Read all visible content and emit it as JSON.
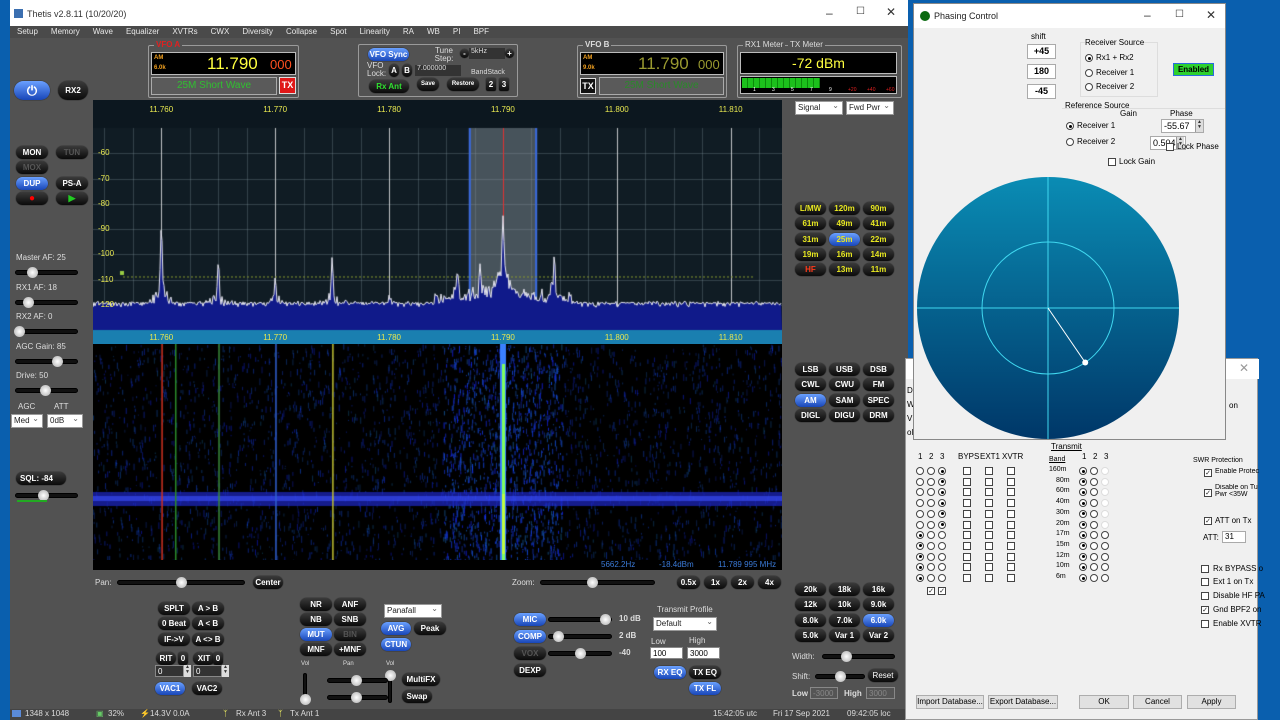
{
  "window": {
    "title": "Thetis v2.8.11 (10/20/20)"
  },
  "menu": [
    "Setup",
    "Memory",
    "Wave",
    "Equalizer",
    "XVTRs",
    "CWX",
    "Diversity",
    "Collapse",
    "Spot",
    "Linearity",
    "RA",
    "WB",
    "PI",
    "BPF"
  ],
  "vfo_a": {
    "label": "VFO A",
    "mode": "AM",
    "filter": "6.0k",
    "freq_main": "11.790",
    "freq_sub": "000",
    "band": "25M Short Wave",
    "tx": "TX"
  },
  "vfo_b": {
    "label": "VFO B",
    "mode": "AM",
    "filter": "9.0k",
    "freq_main": "11.790",
    "freq_sub": "000",
    "band": "25M Short Wave",
    "tx": "TX"
  },
  "vfo_ctrl": {
    "sync": "VFO Sync",
    "tune_step_label": "Tune Step:",
    "tune_step": "5kHz",
    "minus": "-",
    "plus": "+",
    "lock_label": "VFO Lock:",
    "a": "A",
    "b": "B",
    "freq_field": "7.000000",
    "bandstack": "BandStack",
    "rx_ant": "Rx Ant",
    "save": "Save",
    "restore": "Restore",
    "n2": "2",
    "n3": "3"
  },
  "meter": {
    "rx1_label": "RX1 Meter",
    "tx_label": "TX Meter",
    "reading": "-72 dBm",
    "scale": [
      "1",
      "3",
      "5",
      "7",
      "9",
      "+20",
      "+40",
      "+60"
    ],
    "level_fraction": 0.5,
    "rx_select": "Signal",
    "tx_select": "Fwd Pwr"
  },
  "power": {
    "rx2": "RX2"
  },
  "left": {
    "buttons": [
      {
        "label": "MON"
      },
      {
        "label": "TUN",
        "disabled": true
      },
      {
        "label": "MOX",
        "disabled": true
      },
      {
        "label": "DUP",
        "active": true
      },
      {
        "label": "PS-A"
      }
    ],
    "sliders": [
      {
        "label": "Master AF:",
        "value": "25",
        "pos": 0.27
      },
      {
        "label": "RX1 AF:",
        "value": "18",
        "pos": 0.2
      },
      {
        "label": "RX2 AF:",
        "value": "0",
        "pos": 0.05
      },
      {
        "label": "AGC Gain:",
        "value": "85",
        "pos": 0.68
      },
      {
        "label": "Drive:",
        "value": "50",
        "pos": 0.48
      }
    ],
    "agc_label": "AGC",
    "att_label": "ATT",
    "agc": "Med",
    "att": "0dB",
    "sql": "SQL: -84",
    "sql_pos": 0.45
  },
  "spectrum": {
    "freq_ticks": [
      "11.760",
      "11.770",
      "11.780",
      "11.790",
      "11.800",
      "11.810"
    ],
    "freq_values": [
      11.76,
      11.77,
      11.78,
      11.79,
      11.8,
      11.81
    ],
    "freq_range": [
      11.754,
      11.8145
    ],
    "db_ticks": [
      "-60",
      "-70",
      "-80",
      "-90",
      "-100",
      "-110",
      "-120"
    ],
    "db_range": [
      -50,
      -130
    ],
    "noise_floor": -122,
    "squelch_level": -109,
    "vfo_freq": 11.79,
    "filter_khz": [
      -3,
      3
    ],
    "peaks": [
      {
        "f": 11.76,
        "db": -89
      },
      {
        "f": 11.765,
        "db": -104
      },
      {
        "f": 11.77,
        "db": -109
      },
      {
        "f": 11.775,
        "db": -102
      },
      {
        "f": 11.78,
        "db": -116
      },
      {
        "f": 11.786,
        "db": -109
      },
      {
        "f": 11.79,
        "db": -88
      },
      {
        "f": 11.7945,
        "db": -105
      },
      {
        "f": 11.788,
        "db": -108
      }
    ],
    "readout": {
      "hz": "5662.2Hz",
      "dbm": "-18.4dBm",
      "mhz": "11.789 995 MHz"
    }
  },
  "bands": [
    "L/MW",
    "120m",
    "90m",
    "61m",
    "49m",
    "41m",
    "31m",
    "25m",
    "22m",
    "19m",
    "16m",
    "14m",
    "HF",
    "13m",
    "11m"
  ],
  "band_active": "25m",
  "modes": [
    "LSB",
    "USB",
    "DSB",
    "CWL",
    "CWU",
    "FM",
    "AM",
    "SAM",
    "SPEC",
    "DIGL",
    "DIGU",
    "DRM"
  ],
  "mode_active": "AM",
  "pan": {
    "label": "Pan:",
    "pos": 0.5,
    "center": "Center"
  },
  "zoom": {
    "label": "Zoom:",
    "pos": 0.45,
    "buttons": [
      "0.5x",
      "1x",
      "2x",
      "4x"
    ]
  },
  "vfo_buttons": [
    "SPLT",
    "A > B",
    "0 Beat",
    "A < B",
    "IF->V",
    "A <> B"
  ],
  "rit": {
    "rit": "RIT",
    "rit_val": "0",
    "xit": "XIT",
    "xit_val": "0",
    "rit_field": "0",
    "xit_field": "0"
  },
  "vac": [
    "VAC1",
    "VAC2"
  ],
  "dsp": [
    {
      "label": "NR"
    },
    {
      "label": "ANF"
    },
    {
      "label": "NB"
    },
    {
      "label": "SNB"
    },
    {
      "label": "MUT",
      "active": true
    },
    {
      "label": "BIN",
      "disabled": true
    },
    {
      "label": "MNF"
    },
    {
      "label": "+MNF"
    }
  ],
  "display": {
    "mode": "Panafall",
    "avg": "AVG",
    "peak": "Peak",
    "ctun": "CTUN",
    "vol": "Vol",
    "pan": "Pan",
    "vol2": "Vol",
    "multifx": "MultiFX",
    "swap": "Swap"
  },
  "tx": [
    {
      "label": "MIC",
      "active": true,
      "value": "10 dB",
      "pos": 0.9
    },
    {
      "label": "COMP",
      "active": true,
      "value": "2 dB",
      "pos": 0.15
    },
    {
      "label": "VOX",
      "disabled": true,
      "value": "-40",
      "pos": 0.5
    },
    {
      "label": "DEXP"
    }
  ],
  "tx_profile": {
    "label": "Transmit Profile",
    "value": "Default",
    "low_label": "Low",
    "high_label": "High",
    "low": "100",
    "high": "3000",
    "rx_eq": "RX EQ",
    "tx_eq": "TX EQ",
    "tx_fl": "TX FL"
  },
  "filters": [
    "20k",
    "18k",
    "16k",
    "12k",
    "10k",
    "9.0k",
    "8.0k",
    "7.0k",
    "6.0k",
    "5.0k",
    "Var 1",
    "Var 2"
  ],
  "filter_active": "6.0k",
  "filter_ctrl": {
    "width": "Width:",
    "shift": "Shift:",
    "reset": "Reset",
    "low": "Low",
    "high": "High",
    "low_val": "-3000",
    "high_val": "3000",
    "width_pos": 0.33,
    "shift_pos": 0.5
  },
  "status": {
    "resolution": "1348 x 1048",
    "cpu": "32%",
    "power": "14.3V  0.0A",
    "rx_ant": "Rx Ant 3",
    "tx_ant": "Tx Ant 1",
    "utc": "15:42:05 utc",
    "date": "Fri 17 Sep 2021",
    "local": "09:42:05 loc"
  },
  "phasing": {
    "title": "Phasing Control",
    "shift_label": "shift",
    "shifts": [
      "+45",
      "180",
      "-45"
    ],
    "receiver_source": "Receiver Source",
    "rx_options": [
      "Rx1 + Rx2",
      "Receiver 1",
      "Receiver 2"
    ],
    "rx_selected": 0,
    "enabled": "Enabled",
    "reference_source": "Reference Source",
    "ref_options": [
      "Receiver 1",
      "Receiver 2"
    ],
    "ref_selected": 0,
    "gain_label": "Gain",
    "gain": "0.504",
    "phase_label": "Phase",
    "phase": "-55.67",
    "lock_phase": "Lock Phase",
    "lock_gain": "Lock Gain",
    "gain_value": 0.504,
    "phase_value": -55.67
  },
  "setup": {
    "side_letters": [
      "D",
      "W",
      "VL",
      "ol"
    ],
    "tab_fragment": "on",
    "rx_header": [
      "1",
      "2",
      "3"
    ],
    "cols": [
      "BYPS",
      "EXT1",
      "XVTR"
    ],
    "transmit": "Transmit",
    "band": "Band",
    "tx_header": [
      "1",
      "2",
      "3"
    ],
    "bands": [
      "160m",
      "80m",
      "60m",
      "40m",
      "30m",
      "20m",
      "17m",
      "15m",
      "12m",
      "10m",
      "6m"
    ],
    "rx_selected": [
      3,
      3,
      3,
      3,
      3,
      3,
      1,
      1,
      1,
      1,
      1
    ],
    "swr_title": "SWR Protection",
    "swr": [
      "Enable Protec",
      "Disable on Tu Pwr <35W"
    ],
    "att_on_tx": "ATT on Tx",
    "att_label": "ATT:",
    "att": "31",
    "options": [
      {
        "label": "Rx BYPASS o",
        "checked": false
      },
      {
        "label": "Ext 1 on Tx",
        "checked": false
      },
      {
        "label": "Disable HF PA",
        "checked": false
      },
      {
        "label": "Gnd BPF2 on",
        "checked": true
      },
      {
        "label": "Enable XVTR",
        "checked": false
      }
    ],
    "buttons": [
      "Import Database...",
      "Export Database...",
      "OK",
      "Cancel",
      "Apply"
    ]
  }
}
